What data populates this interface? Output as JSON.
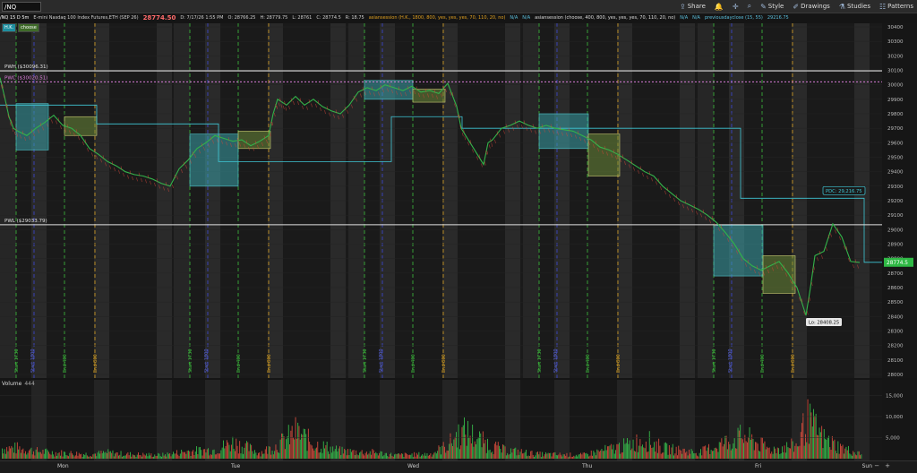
{
  "toolbar": {
    "symbol": "/NQ",
    "share": "Share",
    "style": "Style",
    "drawings": "Drawings",
    "studies": "Studies",
    "patterns": "Patterns"
  },
  "info": {
    "timeframe": "/NQ 15 D 5m",
    "description": "E-mini Nasdaq 100 Index Futures,ETH (SEP 26)",
    "last": "28774.50",
    "date": "D: 7/17/26 1:55 PM",
    "open": "O: 28766.25",
    "high": "H: 28779.75",
    "low": "L: 28761",
    "close": "C: 28774.5",
    "range": "R: 18.75",
    "study1": "asiansession (H.K., 1800, 800, yes, yes, yes, 70, 110, 20, no)",
    "study1_na": "N/A",
    "study2_na": "N/A",
    "study2": "asiansession (choose, 400, 800, yes, yes, yes, 70, 110, 20, no)",
    "study3_na": "N/A",
    "study4_na": "N/A",
    "study4": "previousdayclose (15, 55)",
    "prev_close_value": "29216.75"
  },
  "study_labels": {
    "a": "H.K.",
    "b": "choose"
  },
  "volume": {
    "label": "Volume",
    "value": "444"
  },
  "days": [
    "Mon",
    "Tue",
    "Wed",
    "Thu",
    "Fri",
    "Sun"
  ],
  "zoom": {
    "minus": "−",
    "plus": "+"
  },
  "chart_data": {
    "type": "line",
    "price_axis": {
      "min": 28000,
      "max": 30400,
      "ticks": [
        28000,
        28100,
        28200,
        28300,
        28400,
        28500,
        28600,
        28700,
        28800,
        28900,
        29000,
        29100,
        29200,
        29300,
        29400,
        29500,
        29600,
        29700,
        29800,
        29900,
        30000,
        30100,
        30200,
        30300,
        30400
      ]
    },
    "volume_axis": {
      "min": 0,
      "max": 17000,
      "ticks": [
        "5,000",
        "10,000",
        "15,000"
      ],
      "tick_values": [
        5000,
        10000,
        15000
      ]
    },
    "levels": [
      {
        "label": "PWH ($30096.31)",
        "value": 30096.31,
        "color": "#e0e0e0"
      },
      {
        "label": "PWC ($30020.51)",
        "value": 30020.51,
        "color": "#d77bd7"
      },
      {
        "label": "PWL ($29033.79)",
        "value": 29033.79,
        "color": "#e0e0e0"
      }
    ],
    "annotations": {
      "pdc": "PDC: 29,216.75",
      "low": "Lo: 28408.25",
      "last_price": "28774.5"
    },
    "session_labels": [
      "Start 1730",
      "Start 1800",
      "End 400",
      "End 800"
    ],
    "price_path": [
      [
        0,
        30050
      ],
      [
        5,
        29920
      ],
      [
        10,
        29780
      ],
      [
        15,
        29700
      ],
      [
        20,
        29680
      ],
      [
        30,
        29650
      ],
      [
        40,
        29700
      ],
      [
        50,
        29740
      ],
      [
        60,
        29790
      ],
      [
        70,
        29720
      ],
      [
        80,
        29700
      ],
      [
        90,
        29650
      ],
      [
        100,
        29560
      ],
      [
        110,
        29520
      ],
      [
        120,
        29470
      ],
      [
        130,
        29440
      ],
      [
        140,
        29400
      ],
      [
        150,
        29380
      ],
      [
        160,
        29370
      ],
      [
        170,
        29350
      ],
      [
        180,
        29320
      ],
      [
        190,
        29300
      ],
      [
        200,
        29420
      ],
      [
        210,
        29480
      ],
      [
        220,
        29560
      ],
      [
        230,
        29600
      ],
      [
        240,
        29650
      ],
      [
        250,
        29630
      ],
      [
        260,
        29610
      ],
      [
        270,
        29620
      ],
      [
        280,
        29580
      ],
      [
        290,
        29610
      ],
      [
        300,
        29650
      ],
      [
        305,
        29800
      ],
      [
        310,
        29900
      ],
      [
        315,
        29880
      ],
      [
        320,
        29860
      ],
      [
        330,
        29920
      ],
      [
        340,
        29860
      ],
      [
        350,
        29900
      ],
      [
        360,
        29850
      ],
      [
        370,
        29820
      ],
      [
        380,
        29800
      ],
      [
        390,
        29860
      ],
      [
        400,
        29950
      ],
      [
        410,
        29980
      ],
      [
        420,
        29960
      ],
      [
        430,
        30000
      ],
      [
        440,
        29980
      ],
      [
        450,
        29960
      ],
      [
        460,
        29990
      ],
      [
        470,
        29950
      ],
      [
        480,
        29960
      ],
      [
        490,
        29940
      ],
      [
        500,
        30010
      ],
      [
        510,
        29850
      ],
      [
        515,
        29700
      ],
      [
        520,
        29650
      ],
      [
        530,
        29550
      ],
      [
        540,
        29450
      ],
      [
        545,
        29600
      ],
      [
        550,
        29620
      ],
      [
        560,
        29700
      ],
      [
        570,
        29720
      ],
      [
        580,
        29750
      ],
      [
        590,
        29720
      ],
      [
        600,
        29700
      ],
      [
        610,
        29720
      ],
      [
        620,
        29700
      ],
      [
        630,
        29690
      ],
      [
        640,
        29680
      ],
      [
        650,
        29650
      ],
      [
        660,
        29620
      ],
      [
        670,
        29570
      ],
      [
        680,
        29550
      ],
      [
        690,
        29520
      ],
      [
        700,
        29480
      ],
      [
        710,
        29440
      ],
      [
        720,
        29400
      ],
      [
        730,
        29370
      ],
      [
        740,
        29300
      ],
      [
        750,
        29250
      ],
      [
        760,
        29200
      ],
      [
        770,
        29170
      ],
      [
        780,
        29140
      ],
      [
        790,
        29100
      ],
      [
        800,
        29050
      ],
      [
        810,
        28980
      ],
      [
        820,
        28900
      ],
      [
        830,
        28800
      ],
      [
        840,
        28750
      ],
      [
        850,
        28720
      ],
      [
        860,
        28750
      ],
      [
        870,
        28780
      ],
      [
        880,
        28700
      ],
      [
        890,
        28600
      ],
      [
        900,
        28408
      ],
      [
        905,
        28600
      ],
      [
        910,
        28820
      ],
      [
        920,
        28850
      ],
      [
        930,
        29040
      ],
      [
        940,
        28950
      ],
      [
        950,
        28780
      ],
      [
        960,
        28774
      ]
    ],
    "volume_path": [
      [
        20,
        3500
      ],
      [
        40,
        2500
      ],
      [
        60,
        2000
      ],
      [
        80,
        1800
      ],
      [
        100,
        1500
      ],
      [
        120,
        2000
      ],
      [
        140,
        1500
      ],
      [
        180,
        1200
      ],
      [
        210,
        2500
      ],
      [
        240,
        3000
      ],
      [
        260,
        5500
      ],
      [
        290,
        2000
      ],
      [
        310,
        4500
      ],
      [
        330,
        9000
      ],
      [
        350,
        5000
      ],
      [
        380,
        2500
      ],
      [
        420,
        2000
      ],
      [
        440,
        1200
      ],
      [
        480,
        1500
      ],
      [
        500,
        4500
      ],
      [
        510,
        8000
      ],
      [
        520,
        9000
      ],
      [
        540,
        5500
      ],
      [
        560,
        3000
      ],
      [
        600,
        1500
      ],
      [
        650,
        1200
      ],
      [
        700,
        4500
      ],
      [
        720,
        6500
      ],
      [
        740,
        3500
      ],
      [
        780,
        2000
      ],
      [
        810,
        5500
      ],
      [
        830,
        7500
      ],
      [
        860,
        3000
      ],
      [
        890,
        4500
      ],
      [
        900,
        13000
      ],
      [
        910,
        10000
      ],
      [
        920,
        6500
      ],
      [
        940,
        3500
      ],
      [
        960,
        1500
      ]
    ]
  }
}
